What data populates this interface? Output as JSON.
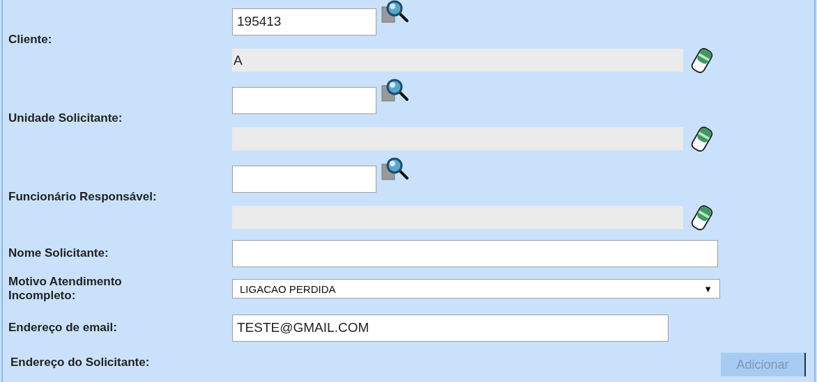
{
  "fields": [
    {
      "kind": "lookup",
      "label": "Cliente:",
      "value": "195413",
      "description": "A"
    },
    {
      "kind": "lookup",
      "label": "Unidade Solicitante:"
    },
    {
      "kind": "lookup",
      "label": "Funcionário Responsável:"
    },
    {
      "kind": "text",
      "label": "Nome Solicitante:"
    },
    {
      "kind": "select",
      "label": "Motivo Atendimento Incompleto:",
      "value": "LIGACAO PERDIDA",
      "caret": "▼"
    },
    {
      "kind": "email",
      "label": "Endereço de email:",
      "value": "TESTE@GMAIL.COM"
    }
  ],
  "address": {
    "label": "Endereço do Solicitante:",
    "button": {
      "label": "Adicionar",
      "disabled": true
    }
  }
}
